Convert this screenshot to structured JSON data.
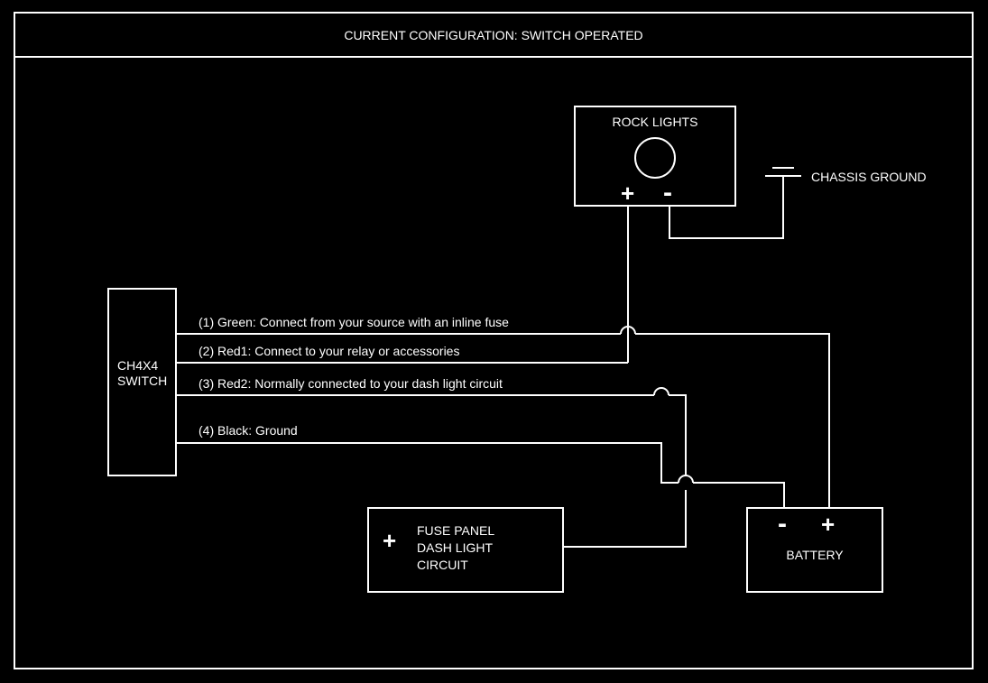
{
  "title": "CURRENT CONFIGURATION: SWITCH OPERATED",
  "switch": {
    "line1": "CH4X4",
    "line2": "SWITCH"
  },
  "rocklights": {
    "label": "ROCK LIGHTS",
    "plus": "+",
    "minus": "-"
  },
  "chassis_ground": "CHASSIS GROUND",
  "battery": {
    "label": "BATTERY",
    "plus": "+",
    "minus": "-"
  },
  "fuse": {
    "plus": "+",
    "line1": "FUSE PANEL",
    "line2": "DASH LIGHT",
    "line3": "CIRCUIT"
  },
  "wires": {
    "w1": "(1) Green: Connect from your source with an inline fuse",
    "w2": "(2) Red1: Connect to your relay or accessories",
    "w3": "(3) Red2: Normally connected to your dash light circuit",
    "w4": "(4) Black: Ground"
  }
}
